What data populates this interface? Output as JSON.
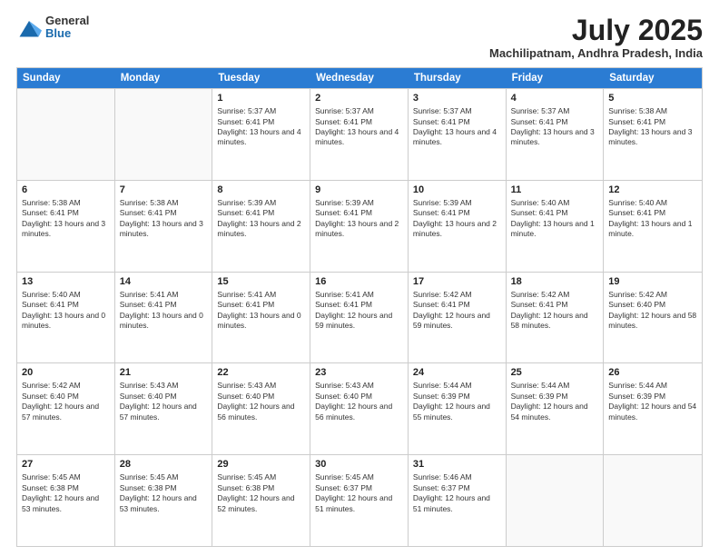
{
  "header": {
    "logo": {
      "general": "General",
      "blue": "Blue"
    },
    "title": "July 2025",
    "location": "Machilipatnam, Andhra Pradesh, India"
  },
  "weekdays": [
    "Sunday",
    "Monday",
    "Tuesday",
    "Wednesday",
    "Thursday",
    "Friday",
    "Saturday"
  ],
  "weeks": [
    [
      {
        "day": "",
        "empty": true
      },
      {
        "day": "",
        "empty": true
      },
      {
        "day": "1",
        "sunrise": "Sunrise: 5:37 AM",
        "sunset": "Sunset: 6:41 PM",
        "daylight": "Daylight: 13 hours and 4 minutes."
      },
      {
        "day": "2",
        "sunrise": "Sunrise: 5:37 AM",
        "sunset": "Sunset: 6:41 PM",
        "daylight": "Daylight: 13 hours and 4 minutes."
      },
      {
        "day": "3",
        "sunrise": "Sunrise: 5:37 AM",
        "sunset": "Sunset: 6:41 PM",
        "daylight": "Daylight: 13 hours and 4 minutes."
      },
      {
        "day": "4",
        "sunrise": "Sunrise: 5:37 AM",
        "sunset": "Sunset: 6:41 PM",
        "daylight": "Daylight: 13 hours and 3 minutes."
      },
      {
        "day": "5",
        "sunrise": "Sunrise: 5:38 AM",
        "sunset": "Sunset: 6:41 PM",
        "daylight": "Daylight: 13 hours and 3 minutes."
      }
    ],
    [
      {
        "day": "6",
        "sunrise": "Sunrise: 5:38 AM",
        "sunset": "Sunset: 6:41 PM",
        "daylight": "Daylight: 13 hours and 3 minutes."
      },
      {
        "day": "7",
        "sunrise": "Sunrise: 5:38 AM",
        "sunset": "Sunset: 6:41 PM",
        "daylight": "Daylight: 13 hours and 3 minutes."
      },
      {
        "day": "8",
        "sunrise": "Sunrise: 5:39 AM",
        "sunset": "Sunset: 6:41 PM",
        "daylight": "Daylight: 13 hours and 2 minutes."
      },
      {
        "day": "9",
        "sunrise": "Sunrise: 5:39 AM",
        "sunset": "Sunset: 6:41 PM",
        "daylight": "Daylight: 13 hours and 2 minutes."
      },
      {
        "day": "10",
        "sunrise": "Sunrise: 5:39 AM",
        "sunset": "Sunset: 6:41 PM",
        "daylight": "Daylight: 13 hours and 2 minutes."
      },
      {
        "day": "11",
        "sunrise": "Sunrise: 5:40 AM",
        "sunset": "Sunset: 6:41 PM",
        "daylight": "Daylight: 13 hours and 1 minute."
      },
      {
        "day": "12",
        "sunrise": "Sunrise: 5:40 AM",
        "sunset": "Sunset: 6:41 PM",
        "daylight": "Daylight: 13 hours and 1 minute."
      }
    ],
    [
      {
        "day": "13",
        "sunrise": "Sunrise: 5:40 AM",
        "sunset": "Sunset: 6:41 PM",
        "daylight": "Daylight: 13 hours and 0 minutes."
      },
      {
        "day": "14",
        "sunrise": "Sunrise: 5:41 AM",
        "sunset": "Sunset: 6:41 PM",
        "daylight": "Daylight: 13 hours and 0 minutes."
      },
      {
        "day": "15",
        "sunrise": "Sunrise: 5:41 AM",
        "sunset": "Sunset: 6:41 PM",
        "daylight": "Daylight: 13 hours and 0 minutes."
      },
      {
        "day": "16",
        "sunrise": "Sunrise: 5:41 AM",
        "sunset": "Sunset: 6:41 PM",
        "daylight": "Daylight: 12 hours and 59 minutes."
      },
      {
        "day": "17",
        "sunrise": "Sunrise: 5:42 AM",
        "sunset": "Sunset: 6:41 PM",
        "daylight": "Daylight: 12 hours and 59 minutes."
      },
      {
        "day": "18",
        "sunrise": "Sunrise: 5:42 AM",
        "sunset": "Sunset: 6:41 PM",
        "daylight": "Daylight: 12 hours and 58 minutes."
      },
      {
        "day": "19",
        "sunrise": "Sunrise: 5:42 AM",
        "sunset": "Sunset: 6:40 PM",
        "daylight": "Daylight: 12 hours and 58 minutes."
      }
    ],
    [
      {
        "day": "20",
        "sunrise": "Sunrise: 5:42 AM",
        "sunset": "Sunset: 6:40 PM",
        "daylight": "Daylight: 12 hours and 57 minutes."
      },
      {
        "day": "21",
        "sunrise": "Sunrise: 5:43 AM",
        "sunset": "Sunset: 6:40 PM",
        "daylight": "Daylight: 12 hours and 57 minutes."
      },
      {
        "day": "22",
        "sunrise": "Sunrise: 5:43 AM",
        "sunset": "Sunset: 6:40 PM",
        "daylight": "Daylight: 12 hours and 56 minutes."
      },
      {
        "day": "23",
        "sunrise": "Sunrise: 5:43 AM",
        "sunset": "Sunset: 6:40 PM",
        "daylight": "Daylight: 12 hours and 56 minutes."
      },
      {
        "day": "24",
        "sunrise": "Sunrise: 5:44 AM",
        "sunset": "Sunset: 6:39 PM",
        "daylight": "Daylight: 12 hours and 55 minutes."
      },
      {
        "day": "25",
        "sunrise": "Sunrise: 5:44 AM",
        "sunset": "Sunset: 6:39 PM",
        "daylight": "Daylight: 12 hours and 54 minutes."
      },
      {
        "day": "26",
        "sunrise": "Sunrise: 5:44 AM",
        "sunset": "Sunset: 6:39 PM",
        "daylight": "Daylight: 12 hours and 54 minutes."
      }
    ],
    [
      {
        "day": "27",
        "sunrise": "Sunrise: 5:45 AM",
        "sunset": "Sunset: 6:38 PM",
        "daylight": "Daylight: 12 hours and 53 minutes."
      },
      {
        "day": "28",
        "sunrise": "Sunrise: 5:45 AM",
        "sunset": "Sunset: 6:38 PM",
        "daylight": "Daylight: 12 hours and 53 minutes."
      },
      {
        "day": "29",
        "sunrise": "Sunrise: 5:45 AM",
        "sunset": "Sunset: 6:38 PM",
        "daylight": "Daylight: 12 hours and 52 minutes."
      },
      {
        "day": "30",
        "sunrise": "Sunrise: 5:45 AM",
        "sunset": "Sunset: 6:37 PM",
        "daylight": "Daylight: 12 hours and 51 minutes."
      },
      {
        "day": "31",
        "sunrise": "Sunrise: 5:46 AM",
        "sunset": "Sunset: 6:37 PM",
        "daylight": "Daylight: 12 hours and 51 minutes."
      },
      {
        "day": "",
        "empty": true
      },
      {
        "day": "",
        "empty": true
      }
    ]
  ]
}
